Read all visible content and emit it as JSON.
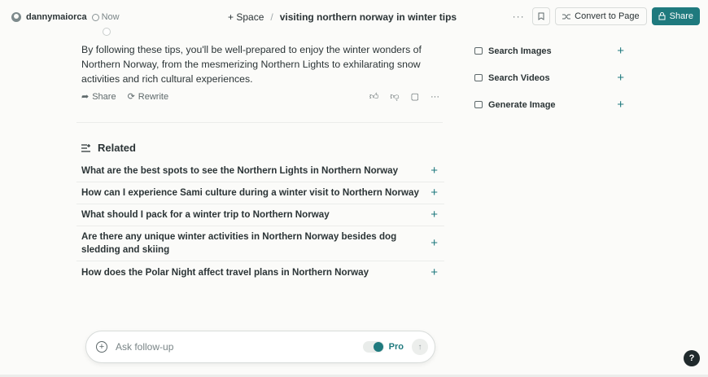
{
  "header": {
    "author": "dannymaiorca",
    "time": "Now",
    "space_label": "+ Space",
    "separator": "/",
    "thread_title": "visiting northern norway in winter tips",
    "more_label": "···",
    "convert_label": "Convert to Page",
    "share_label": "Share"
  },
  "answer": {
    "text": "By following these tips, you'll be well-prepared to enjoy the winter wonders of Northern Norway, from the mesmerizing Northern Lights to exhilarating snow activities and rich cultural experiences.",
    "share_label": "Share",
    "rewrite_label": "Rewrite",
    "more_label": "···"
  },
  "related": {
    "title": "Related",
    "items": [
      "What are the best spots to see the Northern Lights in Northern Norway",
      "How can I experience Sami culture during a winter visit to Northern Norway",
      "What should I pack for a winter trip to Northern Norway",
      "Are there any unique winter activities in Northern Norway besides dog sledding and skiing",
      "How does the Polar Night affect travel plans in Northern Norway"
    ],
    "plus": "+"
  },
  "sidebar": {
    "items": [
      {
        "label": "Search Images",
        "icon": "image-icon"
      },
      {
        "label": "Search Videos",
        "icon": "film-icon"
      },
      {
        "label": "Generate Image",
        "icon": "picture-icon"
      }
    ],
    "plus": "+"
  },
  "followup": {
    "placeholder": "Ask follow-up",
    "pro_label": "Pro",
    "pro_enabled": true
  },
  "help_label": "?",
  "colors": {
    "accent": "#1f7a7e",
    "background": "#fbfbf9",
    "text": "#2b3436"
  }
}
